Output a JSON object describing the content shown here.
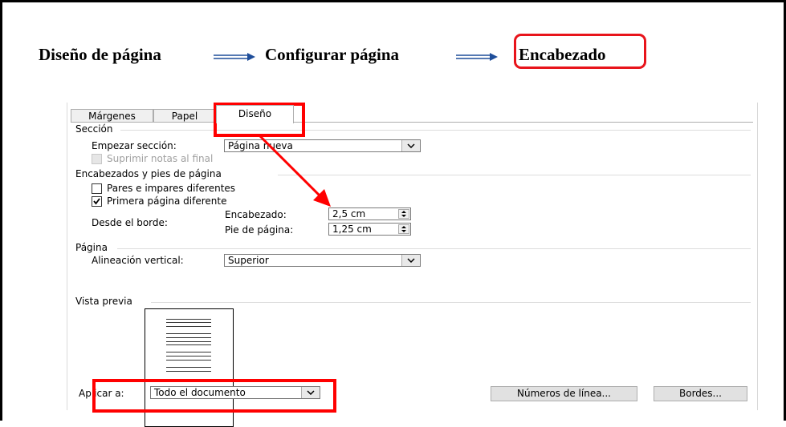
{
  "heading": {
    "step1": "Diseño de página",
    "step2": "Configurar página",
    "step3": "Encabezado"
  },
  "dialog": {
    "tabs": [
      {
        "label": "Márgenes",
        "active": false
      },
      {
        "label": "Papel",
        "active": false
      },
      {
        "label": "Diseño",
        "active": true
      }
    ],
    "seccion": {
      "group_label": "Sección",
      "empezar_label": "Empezar sección:",
      "empezar_value": "Página nueva",
      "suprimir_label": "Suprimir notas al final"
    },
    "encabezados": {
      "group_label": "Encabezados y pies de página",
      "pares_label": "Pares e impares diferentes",
      "pares_checked": false,
      "primera_label": "Primera página diferente",
      "primera_checked": true,
      "desde_label": "Desde el borde:",
      "encabezado_label": "Encabezado:",
      "encabezado_value": "2,5 cm",
      "pie_label": "Pie de página:",
      "pie_value": "1,25 cm"
    },
    "pagina": {
      "group_label": "Página",
      "alineacion_label": "Alineación vertical:",
      "alineacion_value": "Superior"
    },
    "vista_previa": {
      "group_label": "Vista previa"
    },
    "aplicar_label": "Aplicar a:",
    "aplicar_value": "Todo el documento",
    "numeros_button": "Números de línea...",
    "bordes_button": "Bordes..."
  },
  "colors": {
    "highlight": "#ff0000",
    "heading_box": "#e8141b",
    "arrow": "#1f4e9a"
  }
}
